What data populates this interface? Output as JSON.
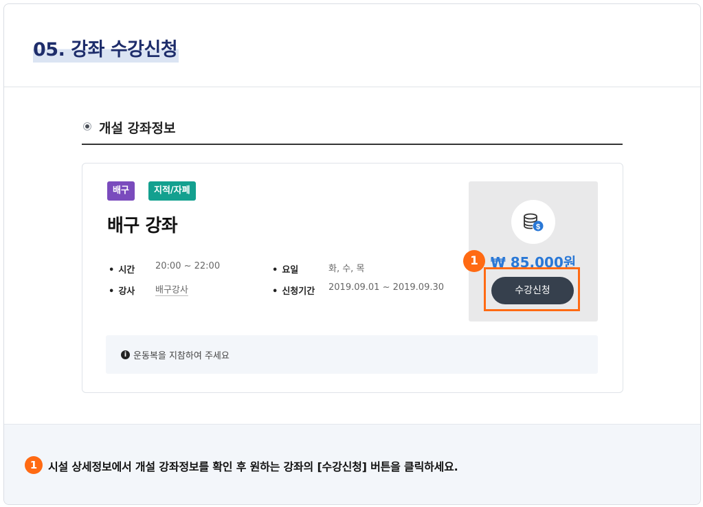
{
  "page": {
    "title": "05. 강좌 수강신청"
  },
  "section": {
    "title": "개설 강좌정보"
  },
  "course": {
    "tags": [
      "배구",
      "지적/자폐"
    ],
    "title": "배구 강좌",
    "info": {
      "time_label": "시간",
      "time_value": "20:00 ~ 22:00",
      "day_label": "요일",
      "day_value": "화, 수, 목",
      "instructor_label": "강사",
      "instructor_value": "배구강사",
      "period_label": "신청기간",
      "period_value": "2019.09.01 ~ 2019.09.30"
    },
    "price": "₩ 85,000원",
    "apply_button": "수강신청",
    "notice": "운동복을 지참하여 주세요"
  },
  "steps": {
    "badge": "1"
  },
  "footer": {
    "badge": "1",
    "instruction": "시설 상세정보에서 개설 강좌정보를 확인 후 원하는 강좌의 [수강신청] 버튼을 클릭하세요."
  },
  "icons": {
    "price": "coin-stack-icon",
    "notice": "info-icon",
    "section": "radio-bullet-icon"
  },
  "colors": {
    "accent": "#ff6a13",
    "title": "#1e2d6b",
    "price": "#2a78d6",
    "tag_purple": "#7a4bbd",
    "tag_teal": "#13a08f",
    "button": "#36404d"
  }
}
